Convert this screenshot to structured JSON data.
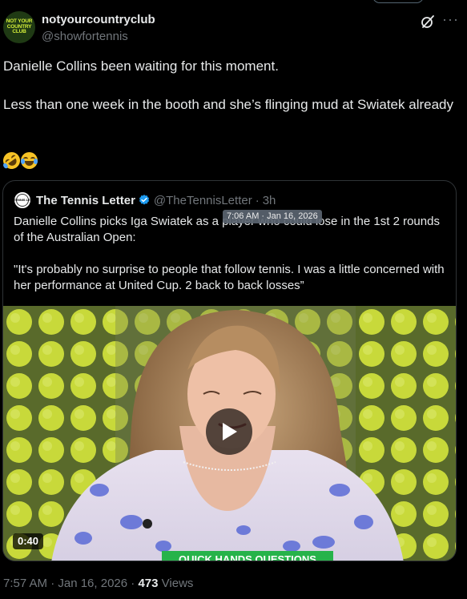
{
  "post": {
    "author": {
      "display_name": "notyourcountryclub",
      "handle": "@showfortennis",
      "avatar_text": "NOT YOUR COUNTRY CLUB"
    },
    "text_line1": "Danielle Collins been waiting for this moment.",
    "text_line2": "Less than one week in the booth and she’s flinging mud at Swiatek already",
    "emojis": [
      "rolling-on-floor-laughing-emoji",
      "tears-of-joy-emoji"
    ]
  },
  "quote": {
    "author_name": "The Tennis Letter",
    "author_handle": "@TheTennisLetter",
    "separator": "·",
    "time": "3h",
    "avatar_text": "THE TENNIS LETTER",
    "text_line1": "Danielle Collins picks Iga Swiatek as a player who could lose in the 1st 2 rounds of the Australian Open:",
    "text_line2": "\"It's probably no surprise to people that follow tennis. I was a little concerned with her performance at United Cup. 2 back to back losses”",
    "tooltip": "7:06 AM · Jan 16, 2026",
    "video": {
      "duration": "0:40",
      "caption": "QUICK HANDS QUESTIONS"
    }
  },
  "meta": {
    "timestamp": "7:57 AM · Jan 16, 2026",
    "separator": "·",
    "views_count": "473",
    "views_label": "Views"
  },
  "colors": {
    "background": "#000000",
    "text_primary": "#e7e9ea",
    "text_secondary": "#71767b",
    "border": "#2f3336",
    "verified_blue": "#1d9bf0",
    "caption_green": "#26b34a"
  }
}
